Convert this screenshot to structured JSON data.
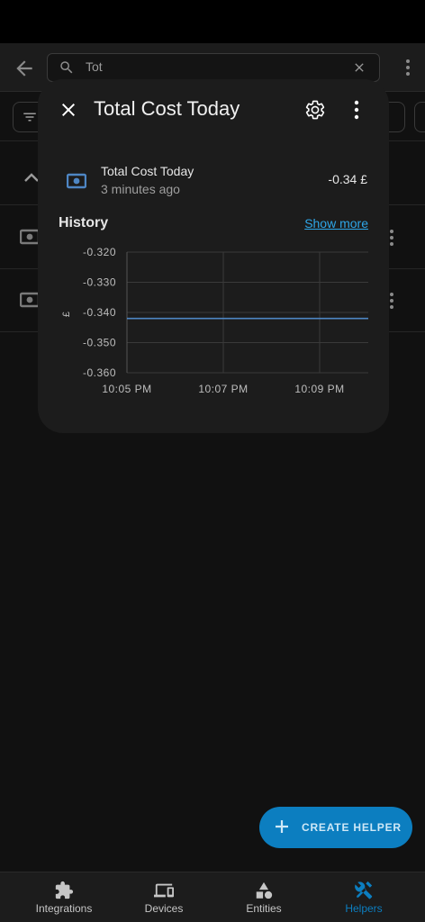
{
  "search": {
    "value": "Tot"
  },
  "dialog": {
    "title": "Total Cost Today",
    "entity": {
      "name": "Total Cost Today",
      "last_changed": "3 minutes ago",
      "value": "-0.34 £"
    },
    "history_label": "History",
    "show_more_label": "Show more"
  },
  "chart_data": {
    "type": "line",
    "ylabel": "£",
    "ylim": [
      -0.36,
      -0.32
    ],
    "yticks": [
      "-0.320",
      "-0.330",
      "-0.340",
      "-0.350",
      "-0.360"
    ],
    "xticks": [
      "10:05 PM",
      "10:07 PM",
      "10:09 PM"
    ],
    "series": [
      {
        "values": [
          -0.342,
          -0.342
        ]
      }
    ],
    "line_color": "#4e86c4",
    "grid": true
  },
  "fab": {
    "label": "CREATE HELPER"
  },
  "bottom_nav": [
    {
      "label": "Integrations",
      "icon": "puzzle-icon"
    },
    {
      "label": "Devices",
      "icon": "devices-icon"
    },
    {
      "label": "Entities",
      "icon": "shapes-icon"
    },
    {
      "label": "Helpers",
      "icon": "tools-icon",
      "active": true
    }
  ],
  "colors": {
    "accent": "#0c7ec0",
    "link": "#2ea6e8",
    "surface": "#1c1c1c",
    "background": "#111111"
  }
}
